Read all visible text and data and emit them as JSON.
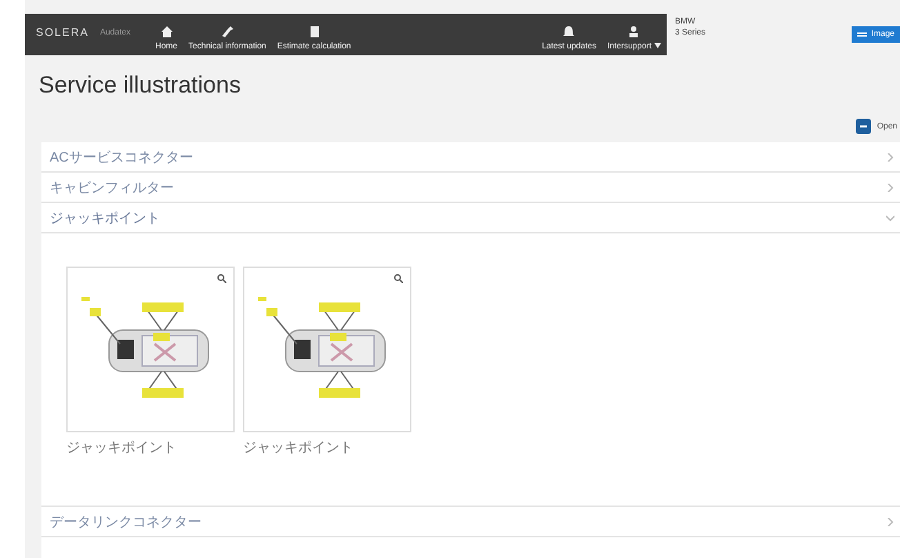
{
  "navbar": {
    "brand": "SOLERA",
    "product": "Audatex",
    "items": [
      {
        "label": "Home"
      },
      {
        "label": "Technical information"
      },
      {
        "label": "Estimate calculation"
      }
    ],
    "right_items": [
      {
        "label": "Latest updates"
      },
      {
        "label": "Intersupport"
      }
    ]
  },
  "vehicle": {
    "make": "BMW",
    "model": "3 Series"
  },
  "image_button": {
    "label": "Image"
  },
  "page_title": "Service illustrations",
  "open_button": {
    "label": "Open"
  },
  "sections": [
    {
      "title": "ACサービスコネクター",
      "expanded": false
    },
    {
      "title": "キャビンフィルター",
      "expanded": false
    },
    {
      "title": "ジャッキポイント",
      "expanded": true,
      "illustrations": [
        {
          "caption": "ジャッキポイント"
        },
        {
          "caption": "ジャッキポイント"
        }
      ]
    },
    {
      "title": "データリンクコネクター",
      "expanded": false
    }
  ]
}
